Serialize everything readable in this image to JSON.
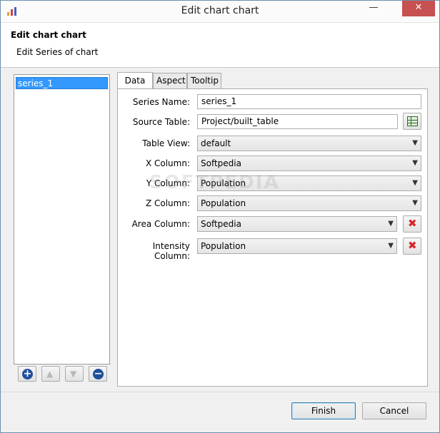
{
  "window": {
    "title": "Edit chart chart",
    "minimize_glyph": "—",
    "close_glyph": "✕"
  },
  "header": {
    "title": "Edit chart chart",
    "subtitle": "Edit Series of chart"
  },
  "series_list": {
    "items": [
      "series_1"
    ],
    "buttons": {
      "add": "+",
      "up": "▲",
      "down": "▼",
      "remove": "−"
    }
  },
  "tabs": [
    {
      "label": "Data",
      "active": true
    },
    {
      "label": "Aspect",
      "active": false
    },
    {
      "label": "Tooltip",
      "active": false
    }
  ],
  "form": {
    "series_name": {
      "label": "Series Name:",
      "value": "series_1"
    },
    "source_table": {
      "label": "Source Table:",
      "value": "Project/built_table"
    },
    "table_view": {
      "label": "Table View:",
      "value": "default"
    },
    "x_column": {
      "label": "X Column:",
      "value": "Softpedia"
    },
    "y_column": {
      "label": "Y Column:",
      "value": "Population"
    },
    "z_column": {
      "label": "Z Column:",
      "value": "Population"
    },
    "area_column": {
      "label": "Area Column:",
      "value": "Softpedia"
    },
    "intensity_column": {
      "label": "Intensity Column:",
      "value": "Population"
    }
  },
  "footer": {
    "finish": "Finish",
    "cancel": "Cancel"
  },
  "watermark": "SOFTPEDIA",
  "colors": {
    "selection": "#3399ff",
    "close_button": "#c75050",
    "delete_x": "#d8262a"
  }
}
